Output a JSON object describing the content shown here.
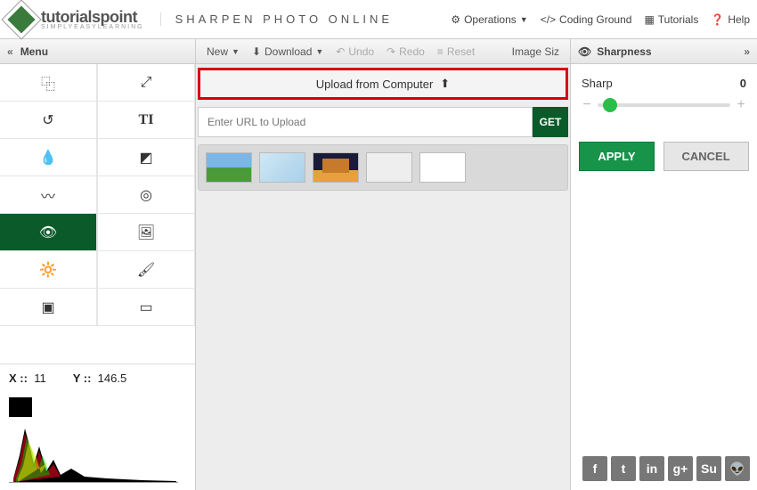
{
  "brand": {
    "name": "tutorialspoint",
    "sub": "SIMPLYEASYLEARNING"
  },
  "header_title": "SHARPEN PHOTO ONLINE",
  "topnav": {
    "operations": "Operations",
    "coding": "Coding Ground",
    "tutorials": "Tutorials",
    "help": "Help"
  },
  "leftPanel": {
    "title": "Menu"
  },
  "tools": {
    "crop": "crop",
    "fullscreen": "fullscreen",
    "rotate": "rotate",
    "text": "text",
    "drop": "drop",
    "levels": "levels",
    "wave": "wave",
    "target": "target",
    "eye": "eye",
    "image": "image",
    "lasso": "lasso",
    "brush": "brush",
    "artboard": "artboard",
    "frame": "frame"
  },
  "coords": {
    "x_label": "X ::",
    "x": "11",
    "y_label": "Y ::",
    "y": "146.5"
  },
  "centerToolbar": {
    "new": "New",
    "download": "Download",
    "undo": "Undo",
    "redo": "Redo",
    "reset": "Reset",
    "imagesize": "Image Siz"
  },
  "upload": {
    "label": "Upload from Computer"
  },
  "url": {
    "placeholder": "Enter URL to Upload",
    "get": "GET"
  },
  "rightPanel": {
    "title": "Sharpness",
    "param": "Sharp",
    "value": "0",
    "apply": "APPLY",
    "cancel": "CANCEL"
  },
  "social": {
    "fb": "f",
    "tw": "t",
    "in": "in",
    "gp": "g+",
    "su": "Su",
    "rd": "👽"
  }
}
